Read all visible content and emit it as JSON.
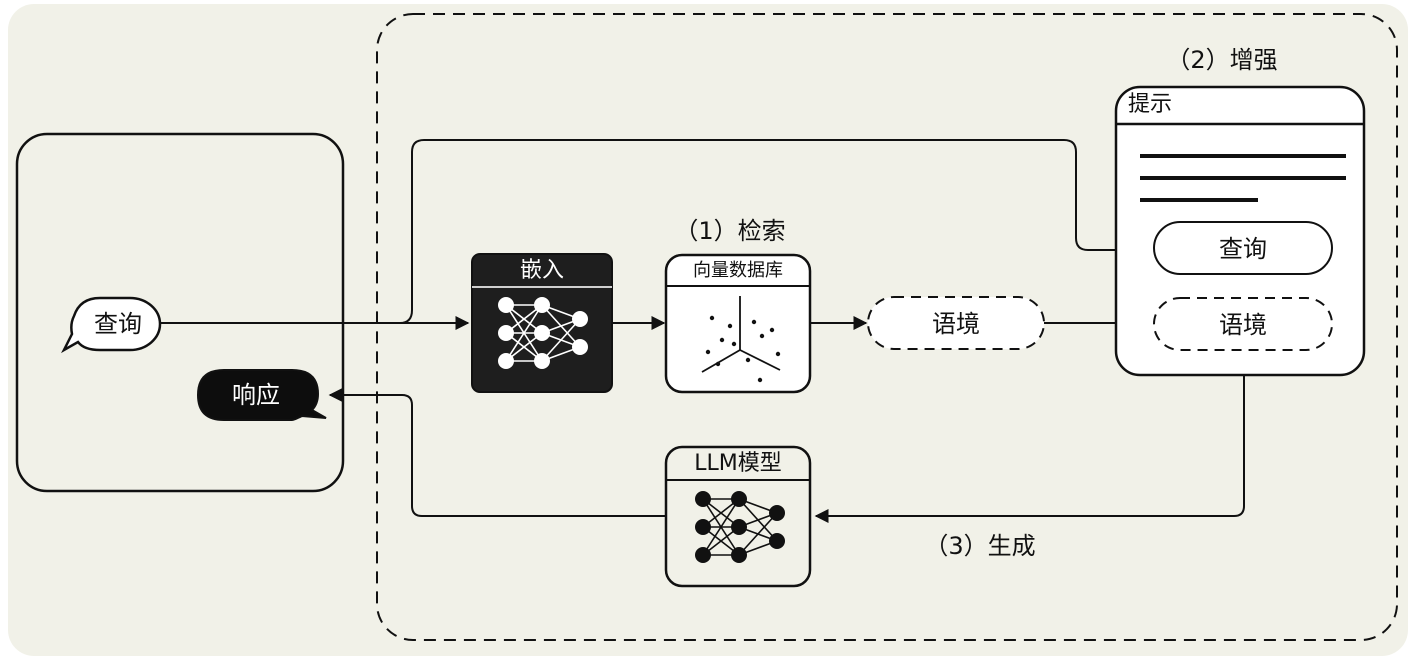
{
  "user_panel": {
    "query_label": "查询",
    "response_label": "响应"
  },
  "embedding": {
    "title": "嵌入"
  },
  "retrieval": {
    "step_label": "（1）检索",
    "vector_db_title": "向量数据库"
  },
  "context": {
    "label": "语境"
  },
  "augment": {
    "step_label": "（2）增强",
    "prompt_title": "提示",
    "query_label": "查询",
    "context_label": "语境"
  },
  "generation": {
    "step_label": "（3）生成",
    "llm_title": "LLM模型"
  },
  "colors": {
    "background": "#f1f1e8",
    "ink": "#111111",
    "embed_box": "#1e1e1e",
    "llm_box": "#f1f1e8"
  }
}
